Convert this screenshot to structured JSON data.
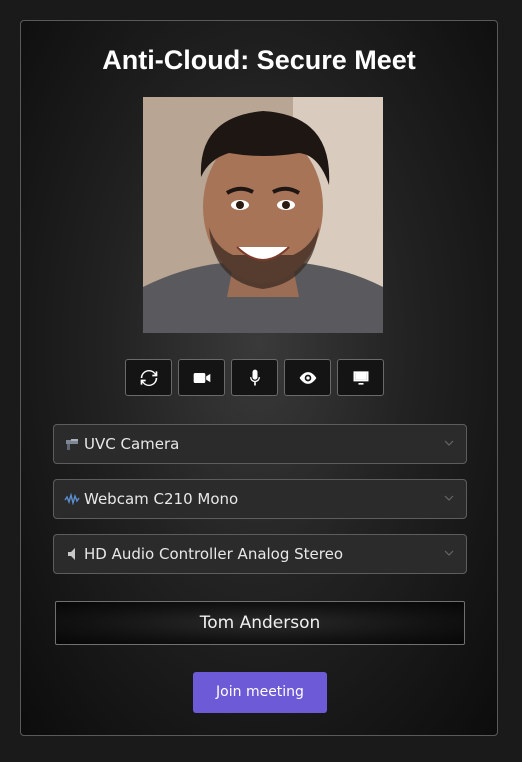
{
  "page": {
    "title": "Anti-Cloud: Secure Meet"
  },
  "controls": [
    {
      "icon": "refresh-icon"
    },
    {
      "icon": "video-camera-icon"
    },
    {
      "icon": "microphone-icon"
    },
    {
      "icon": "eye-icon"
    },
    {
      "icon": "monitor-icon"
    }
  ],
  "devices": {
    "camera": {
      "icon": "camera-icon",
      "value": "UVC Camera"
    },
    "microphone": {
      "icon": "audio-wave-icon",
      "value": "Webcam C210 Mono"
    },
    "speaker": {
      "icon": "speaker-icon",
      "value": "HD Audio Controller Analog Stereo"
    }
  },
  "name_field": {
    "value": "Tom Anderson"
  },
  "join_button": {
    "label": "Join meeting"
  },
  "colors": {
    "accent": "#6c5ad6",
    "panel_border": "#5a5a5a"
  }
}
